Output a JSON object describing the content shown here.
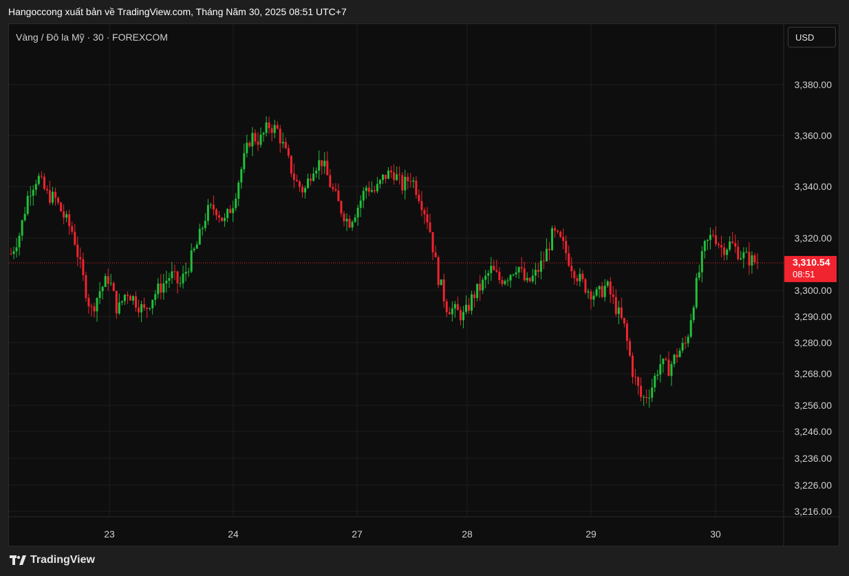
{
  "header": {
    "publish_line": "Hangoccong xuất bản về TradingView.com, Tháng Năm 30, 2025 08:51 UTC+7"
  },
  "chart_header": {
    "symbol_label": "Vàng / Đô la Mỹ · 30 · FOREXCOM",
    "currency": "USD"
  },
  "footer": {
    "brand": "TradingView"
  },
  "colors": {
    "up": "#22c03c",
    "down": "#f0242f",
    "background": "#0e0e0e",
    "grid": "#1f1f1f",
    "price_tag": "#f0242f"
  },
  "chart_data": {
    "type": "candlestick",
    "title": "",
    "xlabel": "",
    "ylabel": "",
    "x_tick_labels": [
      "23",
      "24",
      "27",
      "28",
      "29",
      "30"
    ],
    "y_tick_values": [
      3380,
      3360,
      3340,
      3320,
      3300,
      3290,
      3280,
      3268,
      3256,
      3246,
      3236,
      3226,
      3216
    ],
    "y_tick_labels": [
      "3,380.00",
      "3,360.00",
      "3,340.00",
      "3,320.00",
      "3,300.00",
      "3,290.00",
      "3,280.00",
      "3,268.00",
      "3,256.00",
      "3,246.00",
      "3,236.00",
      "3,226.00",
      "3,216.00"
    ],
    "axis_scale": "non-linear (tick spacing compresses toward lower prices)",
    "current_price": 3310.54,
    "current_price_label": "3,310.54",
    "current_time_label": "08:51",
    "grid": true,
    "price_path": [
      [
        0,
        3314
      ],
      [
        1,
        3322
      ],
      [
        2,
        3338
      ],
      [
        3,
        3344
      ],
      [
        4,
        3337
      ],
      [
        5,
        3335
      ],
      [
        6,
        3328
      ],
      [
        7,
        3322
      ],
      [
        8,
        3306
      ],
      [
        9,
        3292
      ],
      [
        10,
        3300
      ],
      [
        11,
        3305
      ],
      [
        12,
        3292
      ],
      [
        13,
        3300
      ],
      [
        14,
        3296
      ],
      [
        15,
        3292
      ],
      [
        16,
        3298
      ],
      [
        17,
        3302
      ],
      [
        18,
        3306
      ],
      [
        19,
        3302
      ],
      [
        20,
        3310
      ],
      [
        21,
        3318
      ],
      [
        22,
        3330
      ],
      [
        23,
        3332
      ],
      [
        24,
        3326
      ],
      [
        25,
        3334
      ],
      [
        26,
        3348
      ],
      [
        27,
        3360
      ],
      [
        28,
        3358
      ],
      [
        29,
        3364
      ],
      [
        30,
        3362
      ],
      [
        31,
        3352
      ],
      [
        32,
        3342
      ],
      [
        33,
        3338
      ],
      [
        34,
        3348
      ],
      [
        35,
        3350
      ],
      [
        36,
        3340
      ],
      [
        37,
        3332
      ],
      [
        38,
        3326
      ],
      [
        39,
        3332
      ],
      [
        40,
        3340
      ],
      [
        41,
        3338
      ],
      [
        42,
        3344
      ],
      [
        43,
        3346
      ],
      [
        44,
        3340
      ],
      [
        45,
        3344
      ],
      [
        46,
        3336
      ],
      [
        47,
        3326
      ],
      [
        48,
        3306
      ],
      [
        49,
        3294
      ],
      [
        50,
        3292
      ],
      [
        51,
        3290
      ],
      [
        52,
        3298
      ],
      [
        53,
        3302
      ],
      [
        54,
        3308
      ],
      [
        55,
        3304
      ],
      [
        56,
        3306
      ],
      [
        57,
        3310
      ],
      [
        58,
        3302
      ],
      [
        59,
        3306
      ],
      [
        60,
        3312
      ],
      [
        61,
        3322
      ],
      [
        62,
        3318
      ],
      [
        63,
        3310
      ],
      [
        64,
        3304
      ],
      [
        65,
        3300
      ],
      [
        66,
        3298
      ],
      [
        67,
        3302
      ],
      [
        68,
        3294
      ],
      [
        69,
        3286
      ],
      [
        70,
        3268
      ],
      [
        71,
        3258
      ],
      [
        72,
        3262
      ],
      [
        73,
        3272
      ],
      [
        74,
        3270
      ],
      [
        75,
        3276
      ],
      [
        76,
        3280
      ],
      [
        77,
        3300
      ],
      [
        78,
        3316
      ],
      [
        79,
        3322
      ],
      [
        80,
        3316
      ],
      [
        81,
        3318
      ],
      [
        82,
        3314
      ],
      [
        83,
        3312
      ],
      [
        84,
        3310.54
      ]
    ]
  }
}
